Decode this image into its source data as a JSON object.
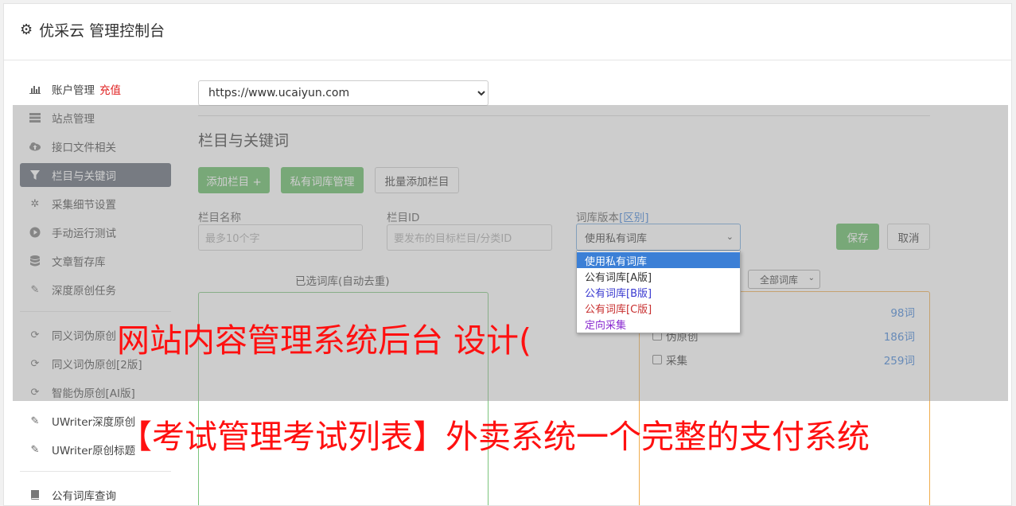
{
  "app": {
    "title": "优采云 管理控制台"
  },
  "sidebar": {
    "items": [
      {
        "label": "账户管理",
        "extra": "充值",
        "icon": "bar-chart-icon"
      },
      {
        "label": "站点管理",
        "icon": "server-icon"
      },
      {
        "label": "接口文件相关",
        "icon": "cloud-upload-icon"
      },
      {
        "label": "栏目与关键词",
        "icon": "filter-icon"
      },
      {
        "label": "采集细节设置",
        "icon": "cogs-icon"
      },
      {
        "label": "手动运行测试",
        "icon": "play-circle-icon"
      },
      {
        "label": "文章暂存库",
        "icon": "database-icon"
      },
      {
        "label": "深度原创任务",
        "icon": "edit-icon"
      },
      {
        "label": "同义词伪原创",
        "icon": "refresh-icon"
      },
      {
        "label": "同义词伪原创[2版]",
        "icon": "refresh-icon"
      },
      {
        "label": "智能伪原创[AI版]",
        "icon": "refresh-icon"
      },
      {
        "label": "UWriter深度原创",
        "icon": "edit-icon"
      },
      {
        "label": "UWriter原创标题",
        "icon": "edit-icon"
      },
      {
        "label": "公有词库查询",
        "icon": "book-icon"
      }
    ]
  },
  "site_select": {
    "value": "https://www.ucaiyun.com"
  },
  "section": {
    "title": "栏目与关键词"
  },
  "buttons": {
    "add_column": "添加栏目 +",
    "private_lib": "私有词库管理",
    "batch_add": "批量添加栏目",
    "save": "保存",
    "cancel": "取消"
  },
  "form": {
    "name_label": "栏目名称",
    "name_placeholder": "最多10个字",
    "id_label": "栏目ID",
    "id_placeholder": "要发布的目标栏目/分类ID",
    "version_label": "词库版本",
    "version_link": "[区别]",
    "version_value": "使用私有词库"
  },
  "dropdown": {
    "options": [
      {
        "label": "使用私有词库",
        "color": "#ffffff",
        "selected": true
      },
      {
        "label": "公有词库[A版]",
        "color": "#333333"
      },
      {
        "label": "公有词库[B版]",
        "color": "#3a3ad0"
      },
      {
        "label": "公有词库[C版]",
        "color": "#c83030"
      },
      {
        "label": "定向采集",
        "color": "#8a2bd0"
      }
    ]
  },
  "selected_panel": {
    "caption": "已选词库(自动去重)"
  },
  "library_panel": {
    "filter": "全部词库",
    "rows": [
      {
        "label": "",
        "count": "98词"
      },
      {
        "label": "伪原创",
        "count": "186词"
      },
      {
        "label": "采集",
        "count": "259词"
      }
    ]
  },
  "watermark": {
    "line1": "网站内容管理系统后台 设计(",
    "line2": "【考试管理考试列表】外卖系统一个完整的支付系统"
  },
  "colors": {
    "accent_green": "#5cb85c",
    "active_nav": "#5a6270",
    "watermark_red": "#ff1010",
    "link_blue": "#3b7fd6"
  }
}
